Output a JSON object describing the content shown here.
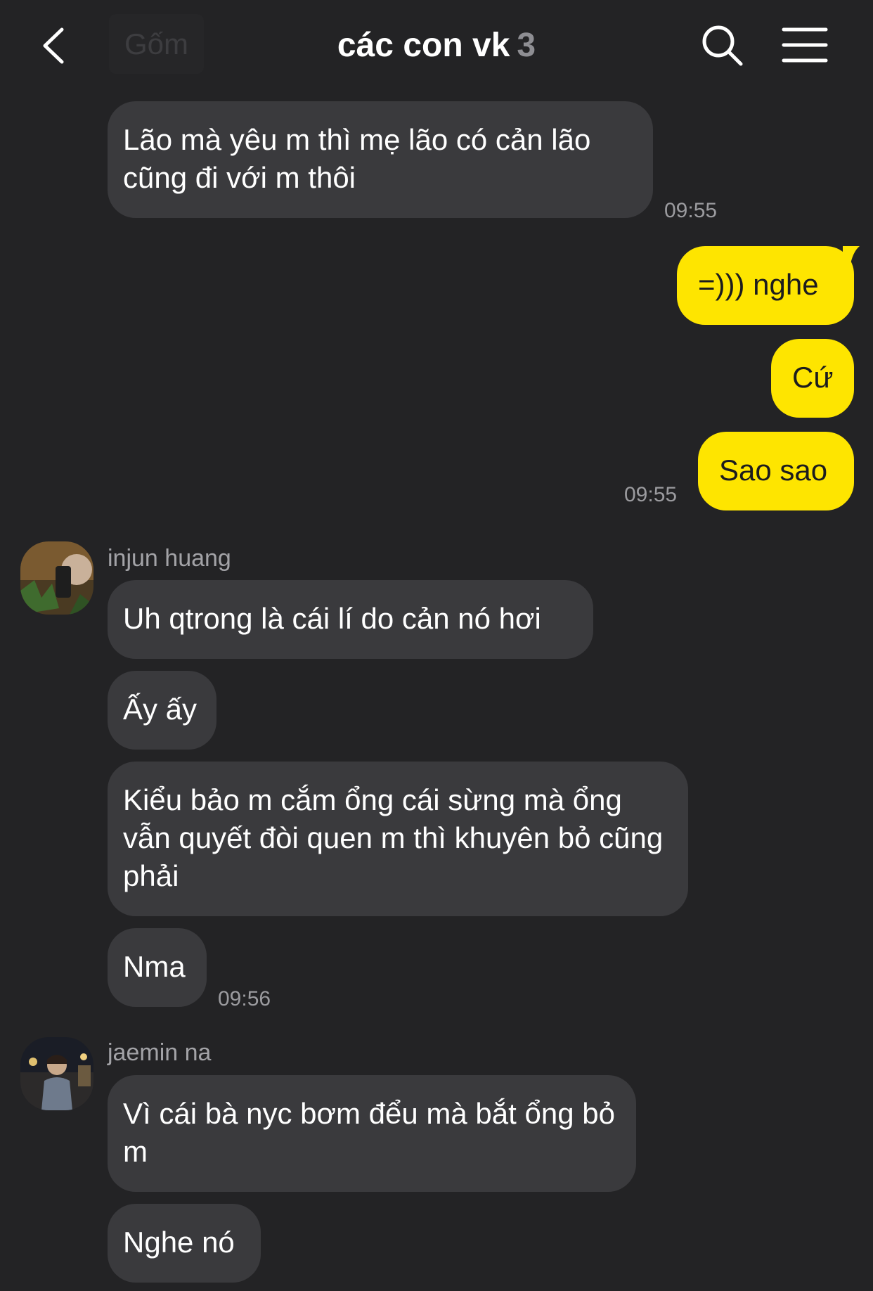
{
  "header": {
    "ghost_label": "Gốm",
    "title": "các con vk",
    "member_count": "3"
  },
  "messages": [
    {
      "text": "Lão mà yêu m thì mẹ lão có cản lão cũng đi với m thôi",
      "time": "09:55"
    },
    {
      "text": "=))) nghe"
    },
    {
      "text": "Cứ"
    },
    {
      "text": "Sao sao",
      "time": "09:55"
    },
    {
      "sender": "injun huang"
    },
    {
      "text": "Uh qtrong là cái lí do cản nó hơi"
    },
    {
      "text": "Ấy ấy"
    },
    {
      "text": "Kiểu bảo m cắm ổng cái sừng mà ổng vẫn quyết đòi quen m thì khuyên bỏ cũng phải"
    },
    {
      "text": "Nma",
      "time": "09:56"
    },
    {
      "sender": "jaemin na"
    },
    {
      "text": "Vì cái bà nyc bơm đểu mà bắt ổng bỏ m"
    },
    {
      "text": "Nghe nó"
    }
  ],
  "colors": {
    "background": "#232325",
    "incoming_bubble": "#3a3a3d",
    "outgoing_bubble": "#fee500",
    "timestamp": "#9b9b9f"
  },
  "icons": [
    "chevron-left-icon",
    "search-icon",
    "menu-icon"
  ]
}
